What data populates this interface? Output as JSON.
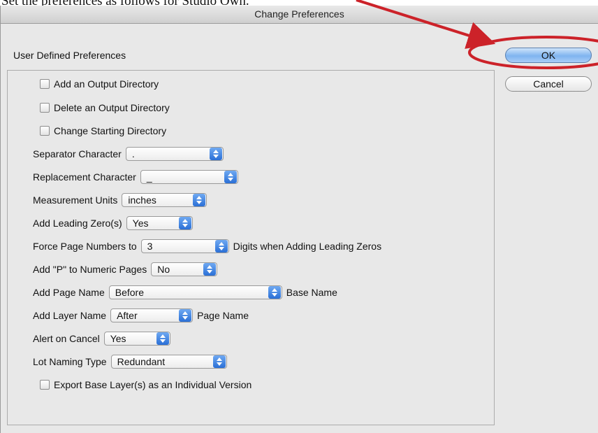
{
  "caption": "Set the preferences as follows for Studio Own.",
  "window": {
    "title": "Change Preferences"
  },
  "section": {
    "title": "User Defined Preferences"
  },
  "buttons": {
    "ok": "OK",
    "cancel": "Cancel"
  },
  "prefs": {
    "add_output_dir": {
      "label": "Add an Output Directory",
      "checked": false
    },
    "delete_output_dir": {
      "label": "Delete an Output Directory",
      "checked": false
    },
    "change_start_dir": {
      "label": "Change Starting Directory",
      "checked": false
    },
    "separator": {
      "label": "Separator Character",
      "value": "."
    },
    "replacement": {
      "label": "Replacement Character",
      "value": "_"
    },
    "units": {
      "label": "Measurement Units",
      "value": "inches"
    },
    "leading_zero": {
      "label": "Add Leading Zero(s)",
      "value": "Yes"
    },
    "force_page": {
      "label": "Force Page Numbers to",
      "value": "3",
      "suffix": "Digits when Adding Leading Zeros"
    },
    "add_p": {
      "label": "Add \"P\" to Numeric Pages",
      "value": "No"
    },
    "page_name": {
      "label": "Add Page Name",
      "value": "Before",
      "suffix": "Base Name"
    },
    "layer_name": {
      "label": "Add Layer Name",
      "value": "After",
      "suffix": "Page Name"
    },
    "alert_cancel": {
      "label": "Alert on Cancel",
      "value": "Yes"
    },
    "lot_naming": {
      "label": "Lot Naming Type",
      "value": "Redundant"
    },
    "export_base": {
      "label": "Export Base Layer(s) as an Individual Version",
      "checked": false
    }
  },
  "colors": {
    "annotation": "#cc2229",
    "select_arrow": "#2a6fd6",
    "ok_button": "#7fb4f0"
  }
}
